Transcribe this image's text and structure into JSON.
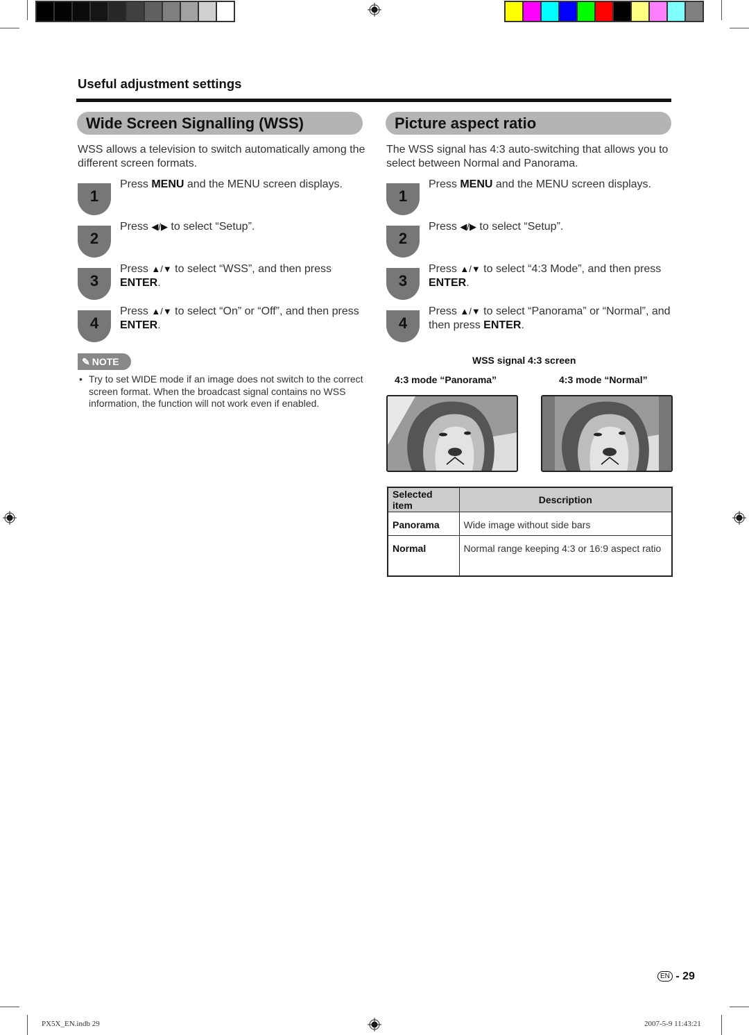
{
  "print_marks": {
    "gray_swatches": [
      "#000000",
      "#030303",
      "#0b0b0b",
      "#151515",
      "#272727",
      "#404040",
      "#606060",
      "#7f7f7f",
      "#a1a1a1",
      "#d0d0d0",
      "#ffffff"
    ],
    "color_swatches": [
      "#ffff00",
      "#ff00ff",
      "#00ffff",
      "#0000ff",
      "#00ff00",
      "#ff0000",
      "#000000",
      "#ffff80",
      "#ff80ff",
      "#80ffff",
      "#808080"
    ]
  },
  "header": {
    "section_title": "Useful adjustment settings"
  },
  "wss": {
    "title": "Wide Screen Signalling (WSS)",
    "intro": "WSS allows a television to switch automatically among the different screen formats.",
    "steps": [
      {
        "num": "1",
        "pre": "Press ",
        "key": "MENU",
        "post": " and the MENU screen displays.",
        "arrows": "",
        "pre2": "",
        "key2": "",
        "post2": ""
      },
      {
        "num": "2",
        "pre": "Press ",
        "arrows": "◀/▶",
        "post": " to select “Setup”."
      },
      {
        "num": "3",
        "pre": "Press ",
        "arrows": "▲/▼",
        "post": " to select “WSS”, and then press ",
        "key": "ENTER",
        "end": "."
      },
      {
        "num": "4",
        "pre": "Press ",
        "arrows": "▲/▼",
        "post": " to select “On” or “Off”, and then press ",
        "key": "ENTER",
        "end": "."
      }
    ],
    "note": {
      "label": "NOTE",
      "icon": "paperclip-icon",
      "bullet": "•",
      "text": "Try to set WIDE mode if an image does not switch to the correct screen format. When the broadcast signal contains no WSS information, the function will not work even if enabled."
    }
  },
  "aspect": {
    "title": "Picture aspect ratio",
    "intro": "The WSS signal has 4:3 auto-switching that allows you to select between Normal and Panorama.",
    "steps": [
      {
        "num": "1",
        "pre": "Press ",
        "key": "MENU",
        "post": " and the MENU screen displays."
      },
      {
        "num": "2",
        "pre": "Press ",
        "arrows": "◀/▶",
        "post": " to select “Setup”."
      },
      {
        "num": "3",
        "pre": "Press ",
        "arrows": "▲/▼",
        "post": " to select “4:3 Mode”, and then press ",
        "key": "ENTER",
        "end": "."
      },
      {
        "num": "4",
        "pre": "Press ",
        "arrows": "▲/▼",
        "post": " to select “Panorama” or “Normal”, and then press ",
        "key": "ENTER",
        "end": "."
      }
    ],
    "figure": {
      "title": "WSS signal 4:3 screen",
      "left_caption": "4:3 mode “Panorama”",
      "right_caption": "4:3 mode “Normal”"
    },
    "table": {
      "headers": [
        "Selected item",
        "Description"
      ],
      "rows": [
        {
          "item": "Panorama",
          "desc": "Wide image without side bars"
        },
        {
          "item": "Normal",
          "desc": "Normal range keeping 4:3 or 16:9 aspect ratio"
        }
      ]
    }
  },
  "page": {
    "lang_badge": "EN",
    "separator": "-",
    "number": "29"
  },
  "footer": {
    "file": "PX5X_EN.indb   29",
    "timestamp": "2007-5-9   11:43:21"
  }
}
